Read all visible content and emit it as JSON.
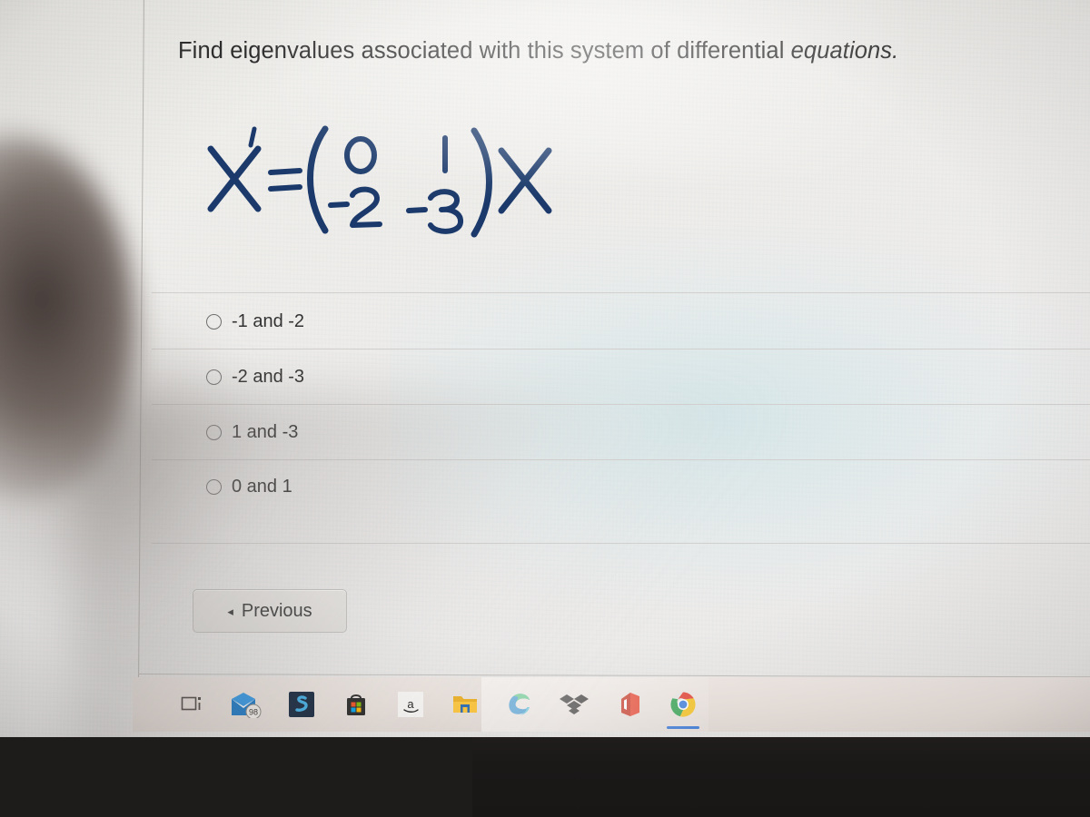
{
  "question": {
    "text_plain": "Find eigenvalues associated with this system of differential ",
    "text_italic": "equations."
  },
  "equation": {
    "label": "handwritten-matrix-equation",
    "lhs": "X'",
    "relation": "=",
    "matrix": [
      [
        "0",
        "1"
      ],
      [
        "-2",
        "-3"
      ]
    ],
    "rhs": "X",
    "ink_color": "#1b3a6b"
  },
  "options": [
    {
      "id": "opt-1",
      "label": "-1 and -2",
      "selected": false
    },
    {
      "id": "opt-2",
      "label": "-2 and -3",
      "selected": false
    },
    {
      "id": "opt-3",
      "label": "1 and -3",
      "selected": false
    },
    {
      "id": "opt-4",
      "label": "0 and 1",
      "selected": false
    }
  ],
  "navigation": {
    "previous_caret": "◂",
    "previous_label": "Previous"
  },
  "taskbar": {
    "items": [
      {
        "name": "task-view-icon",
        "label": "Task View",
        "badge": "",
        "active": false
      },
      {
        "name": "mail-icon",
        "label": "Mail",
        "badge": "98",
        "active": false
      },
      {
        "name": "skype-icon",
        "label": "Skype",
        "badge": "",
        "active": false
      },
      {
        "name": "microsoft-store-icon",
        "label": "Microsoft Store",
        "badge": "",
        "active": false
      },
      {
        "name": "amazon-icon",
        "label": "Amazon",
        "badge": "",
        "active": false
      },
      {
        "name": "file-explorer-icon",
        "label": "File Explorer",
        "badge": "",
        "active": false
      },
      {
        "name": "microsoft-edge-icon",
        "label": "Microsoft Edge",
        "badge": "",
        "active": true
      },
      {
        "name": "dropbox-icon",
        "label": "Dropbox",
        "badge": "",
        "active": false
      },
      {
        "name": "microsoft-office-icon",
        "label": "Microsoft Office",
        "badge": "",
        "active": false
      },
      {
        "name": "google-chrome-icon",
        "label": "Google Chrome",
        "badge": "",
        "active": true
      }
    ],
    "amazon_glyph": "a"
  }
}
